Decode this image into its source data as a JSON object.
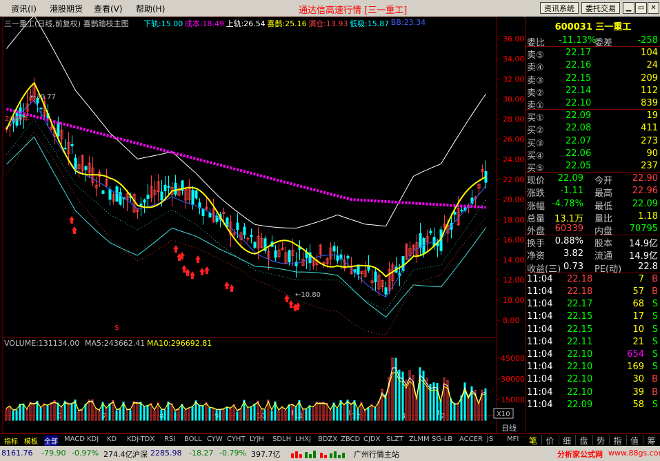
{
  "menu": {
    "items": [
      "资讯(I)",
      "港股期货",
      "查看(V)",
      "帮助(H)"
    ],
    "title": "通达信高速行情 [三一重工]",
    "btn_info": "资讯系统",
    "btn_trade": "委托交易"
  },
  "chart_header": {
    "name": "三一重工(日线,前复权) 喜鹊踏枝主图",
    "items": [
      {
        "text": "下轨:15.00",
        "color": "#00ffff"
      },
      {
        "text": "成本:18.49",
        "color": "#ff00ff"
      },
      {
        "text": "上轨:26.54",
        "color": "#ffffff"
      },
      {
        "text": "喜鹊:25.16",
        "color": "#ffff00"
      },
      {
        "text": "满仓:13.93",
        "color": "#ff4040"
      },
      {
        "text": "低吸:15.87",
        "color": "#00ffff"
      },
      {
        "text": "BB:23.34",
        "color": "#4060ff"
      }
    ]
  },
  "price_axis": [
    "36.00",
    "34.00",
    "32.00",
    "30.00",
    "28.00",
    "26.00",
    "24.00",
    "22.00",
    "20.00",
    "18.00",
    "16.00",
    "14.00",
    "12.00",
    "10.00",
    "8.00"
  ],
  "annotations": {
    "high": "30.77",
    "low": "10.80",
    "year": "2008年"
  },
  "x_labels": [
    "6",
    "7",
    "8",
    "9",
    "10",
    "11",
    "12",
    "1",
    "2"
  ],
  "volume_header": {
    "vol": "VOLUME:131134.00",
    "ma5": "MA5:243662.41",
    "ma10": "MA10:296692.81"
  },
  "volume_axis": [
    "45000",
    "30000",
    "15000"
  ],
  "volume_unit": "X10",
  "period_label": "日线",
  "quote": {
    "code": "600031",
    "name": "三一重工",
    "wei_bi_label": "委比",
    "wei_bi": "-11.13%",
    "wei_cha_label": "委差",
    "wei_cha": "-258",
    "sells": [
      {
        "label": "卖⑤",
        "price": "22.17",
        "vol": "104"
      },
      {
        "label": "卖④",
        "price": "22.16",
        "vol": "24"
      },
      {
        "label": "卖③",
        "price": "22.15",
        "vol": "209"
      },
      {
        "label": "卖②",
        "price": "22.14",
        "vol": "112"
      },
      {
        "label": "卖①",
        "price": "22.10",
        "vol": "839"
      }
    ],
    "buys": [
      {
        "label": "买①",
        "price": "22.09",
        "vol": "19"
      },
      {
        "label": "买②",
        "price": "22.08",
        "vol": "411"
      },
      {
        "label": "买③",
        "price": "22.07",
        "vol": "273"
      },
      {
        "label": "买④",
        "price": "22.06",
        "vol": "90"
      },
      {
        "label": "买⑤",
        "price": "22.05",
        "vol": "237"
      }
    ],
    "stats": [
      {
        "l1": "现价",
        "v1": "22.09",
        "c1": "#00ff00",
        "l2": "今开",
        "v2": "22.90",
        "c2": "#ff4040"
      },
      {
        "l1": "涨跌",
        "v1": "-1.11",
        "c1": "#00ff00",
        "l2": "最高",
        "v2": "22.96",
        "c2": "#ff4040"
      },
      {
        "l1": "涨幅",
        "v1": "-4.78%",
        "c1": "#00ff00",
        "l2": "最低",
        "v2": "22.09",
        "c2": "#00ff00"
      },
      {
        "l1": "总量",
        "v1": "13.1万",
        "c1": "#ffff00",
        "l2": "量比",
        "v2": "1.18",
        "c2": "#ffff00"
      },
      {
        "l1": "外盘",
        "v1": "60339",
        "c1": "#ff4040",
        "l2": "内盘",
        "v2": "70795",
        "c2": "#00ff00"
      }
    ],
    "stats2": [
      {
        "l1": "换手",
        "v1": "0.88%",
        "l2": "股本",
        "v2": "14.9亿"
      },
      {
        "l1": "净资",
        "v1": "3.82",
        "l2": "流通",
        "v2": "14.9亿"
      },
      {
        "l1": "收益(三)",
        "v1": "0.73",
        "l2": "PE(动)",
        "v2": "22.8"
      }
    ],
    "ticks": [
      {
        "t": "11:04",
        "p": "22.18",
        "pc": "#ff4040",
        "v": "7",
        "vc": "#ffff00",
        "s": "B",
        "sc": "#ff4040"
      },
      {
        "t": "11:04",
        "p": "22.18",
        "pc": "#ff4040",
        "v": "57",
        "vc": "#ffff00",
        "s": "B",
        "sc": "#ff4040"
      },
      {
        "t": "11:04",
        "p": "22.17",
        "pc": "#00ff00",
        "v": "68",
        "vc": "#ffff00",
        "s": "S",
        "sc": "#00ff00"
      },
      {
        "t": "11:04",
        "p": "22.15",
        "pc": "#00ff00",
        "v": "17",
        "vc": "#ffff00",
        "s": "S",
        "sc": "#00ff00"
      },
      {
        "t": "11:04",
        "p": "22.15",
        "pc": "#00ff00",
        "v": "10",
        "vc": "#ffff00",
        "s": "S",
        "sc": "#00ff00"
      },
      {
        "t": "11:04",
        "p": "22.11",
        "pc": "#00ff00",
        "v": "21",
        "vc": "#ffff00",
        "s": "S",
        "sc": "#00ff00"
      },
      {
        "t": "11:04",
        "p": "22.10",
        "pc": "#00ff00",
        "v": "654",
        "vc": "#ff00ff",
        "s": "S",
        "sc": "#00ff00"
      },
      {
        "t": "11:04",
        "p": "22.10",
        "pc": "#00ff00",
        "v": "169",
        "vc": "#ffff00",
        "s": "S",
        "sc": "#00ff00"
      },
      {
        "t": "11:04",
        "p": "22.10",
        "pc": "#00ff00",
        "v": "30",
        "vc": "#ffff00",
        "s": "B",
        "sc": "#ff4040"
      },
      {
        "t": "11:04",
        "p": "22.10",
        "pc": "#00ff00",
        "v": "39",
        "vc": "#ffff00",
        "s": "B",
        "sc": "#ff4040"
      },
      {
        "t": "11:04",
        "p": "22.09",
        "pc": "#00ff00",
        "v": "58",
        "vc": "#ffff00",
        "s": "S",
        "sc": "#00ff00"
      }
    ]
  },
  "bottom_tabs": [
    "指标",
    "模板",
    "全部",
    "MACD",
    "KDJ",
    "KD",
    "KDJ-TDX",
    "RSI",
    "BOLL",
    "CYW",
    "CYHT",
    "LYJH",
    "SDLH",
    "LHXJ",
    "BDZX",
    "ZBCD",
    "CJDX",
    "SLZT",
    "ZLMM",
    "SG-LB",
    "ACCER",
    "JS",
    "MFI"
  ],
  "quote_tabs": [
    "笔",
    "价",
    "细",
    "盘",
    "势",
    "指",
    "值",
    "筹"
  ],
  "status": {
    "sh_index": "8161.76",
    "sh_chg": "-79.90",
    "sh_pct": "-0.97%",
    "sh_amt": "274.4亿",
    "sz_label": "沪深",
    "sz_index": "2285.98",
    "sz_chg": "-18.27",
    "sz_pct": "-0.79%",
    "sz_amt": "397.7亿",
    "station": "广州行情主站",
    "site": "分析家公式网",
    "site_url": "www.88gs.com"
  },
  "colors": {
    "up": "#ff4040",
    "down": "#00ff00",
    "axis": "#ff0000",
    "label": "#c0c0c0"
  }
}
